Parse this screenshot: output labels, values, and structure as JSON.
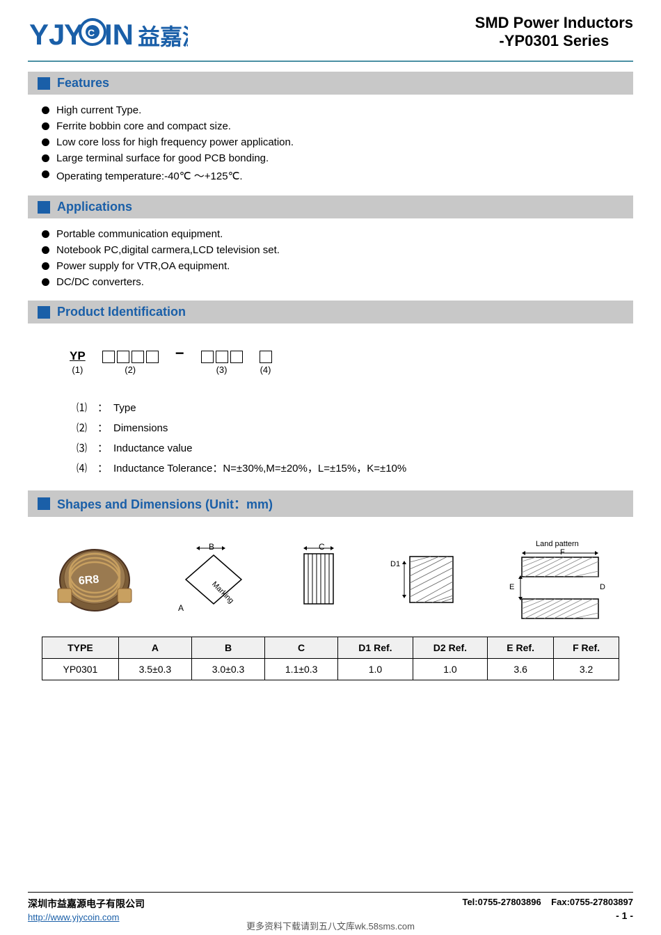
{
  "header": {
    "logo_text": "YJYCOIN",
    "logo_chinese": "益嘉源",
    "title_line1": "SMD Power Inductors",
    "title_line2": "-YP0301 Series"
  },
  "sections": {
    "features": {
      "title": "Features",
      "items": [
        "High current Type.",
        "Ferrite bobbin core and compact size.",
        "Low core loss for high frequency power application.",
        "Large terminal surface for good PCB bonding.",
        "Operating temperature:-40℃ ～+125℃."
      ]
    },
    "applications": {
      "title": "Applications",
      "items": [
        "Portable communication equipment.",
        "Notebook PC,digital carmera,LCD television set.",
        "Power supply for VTR,OA equipment.",
        "DC/DC converters."
      ]
    },
    "product_id": {
      "title": "Product Identification",
      "diagram": {
        "part1_label": "YP",
        "part1_num": "(1)",
        "part2_boxes": 4,
        "part2_num": "(2)",
        "part3_boxes": 3,
        "part3_num": "(3)",
        "part4_boxes": 1,
        "part4_num": "(4)"
      },
      "legend": [
        {
          "num": "⑴",
          "colon": "：",
          "desc": "Type"
        },
        {
          "num": "⑵",
          "colon": "：",
          "desc": "Dimensions"
        },
        {
          "num": "⑶",
          "colon": "：",
          "desc": "Inductance value"
        },
        {
          "num": "⑷",
          "colon": "：",
          "desc": "Inductance Tolerance：N=±30%,M=±20%，L=±15%，K=±10%"
        }
      ]
    },
    "shapes": {
      "title": "Shapes and Dimensions (Unit：mm)",
      "inductor_label": "6R8",
      "table": {
        "headers": [
          "TYPE",
          "A",
          "B",
          "C",
          "D1 Ref.",
          "D2 Ref.",
          "E Ref.",
          "F Ref."
        ],
        "rows": [
          [
            "YP0301",
            "3.5±0.3",
            "3.0±0.3",
            "1.1±0.3",
            "1.0",
            "1.0",
            "3.6",
            "3.2"
          ]
        ]
      }
    }
  },
  "footer": {
    "company": "深圳市益嘉源电子有限公司",
    "website": "http://www.yjycoin.com",
    "tel": "Tel:0755-27803896",
    "fax": "Fax:0755-27803897",
    "page": "- 1 -",
    "watermark": "更多资料下载请到五八文库wk.58sms.com"
  }
}
